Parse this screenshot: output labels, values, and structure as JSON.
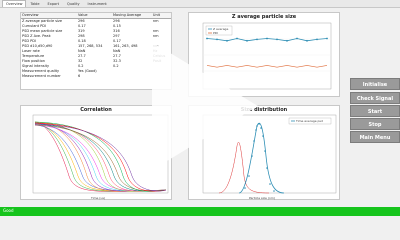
{
  "tabs": [
    "Overview",
    "Table",
    "Export",
    "Quality",
    "Instrument"
  ],
  "results_table": {
    "headers": [
      "Overview",
      "Value",
      "Moving Average",
      "Unit"
    ],
    "rows": [
      [
        "Z average particle size",
        "296",
        "296",
        "nm"
      ],
      [
        "Cumulant PDI",
        "0.17",
        "0.15",
        ""
      ],
      [
        "PSD mean particle size",
        "319",
        "316",
        "nm"
      ],
      [
        "PSD Z Ave. Peak",
        "298",
        "297",
        "nm"
      ],
      [
        "PSD PDI",
        "0.18",
        "0.17",
        ""
      ],
      [
        "PSD d10,d50,d90",
        "157, 268, 534",
        "161, 263, 498",
        "nm"
      ],
      [
        "Laser rate",
        "NaN",
        "NaN",
        "Hz"
      ],
      [
        "Temperature",
        "27.7",
        "27.7",
        "Celsius"
      ],
      [
        "Flow position",
        "32",
        "32.3",
        "Posit"
      ],
      [
        "Signal intensity",
        "0.2",
        "0.2",
        ""
      ],
      [
        "Measurement quality",
        "Yes (Good)",
        "",
        ""
      ],
      [
        "Measurement number",
        "6",
        "",
        ""
      ]
    ]
  },
  "z_chart": {
    "title": "Z average particle size",
    "legend": [
      "Z average",
      "PDI"
    ],
    "colors": {
      "z": "#2f8fb5",
      "pdi": "#e06e3c"
    }
  },
  "correlation_chart": {
    "title": "Correlation",
    "xlabel": "Time (us)"
  },
  "psd_chart": {
    "title": "Size distribution",
    "legend": [
      "Time average psd"
    ],
    "xlabel": "Particle size (nm)"
  },
  "buttons": {
    "initialise": "Initialise",
    "check_signal": "Check Signal",
    "start": "Start",
    "stop": "Stop",
    "main_menu": "Main Menu"
  },
  "status": {
    "text": "Good",
    "color": "#16c41c"
  },
  "overlay": {
    "icon": "play-icon"
  }
}
